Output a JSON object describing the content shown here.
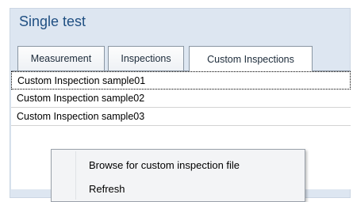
{
  "panel": {
    "title": "Single test"
  },
  "tabs": [
    {
      "label": "Measurement"
    },
    {
      "label": "Inspections"
    },
    {
      "label": "Custom Inspections"
    }
  ],
  "active_tab": "Custom Inspections",
  "list": {
    "items": [
      {
        "label": "Custom Inspection sample01"
      },
      {
        "label": "Custom Inspection sample02"
      },
      {
        "label": "Custom Inspection sample03"
      }
    ]
  },
  "context_menu": {
    "items": [
      {
        "label": "Browse for custom inspection file"
      },
      {
        "label": "Refresh"
      }
    ]
  }
}
